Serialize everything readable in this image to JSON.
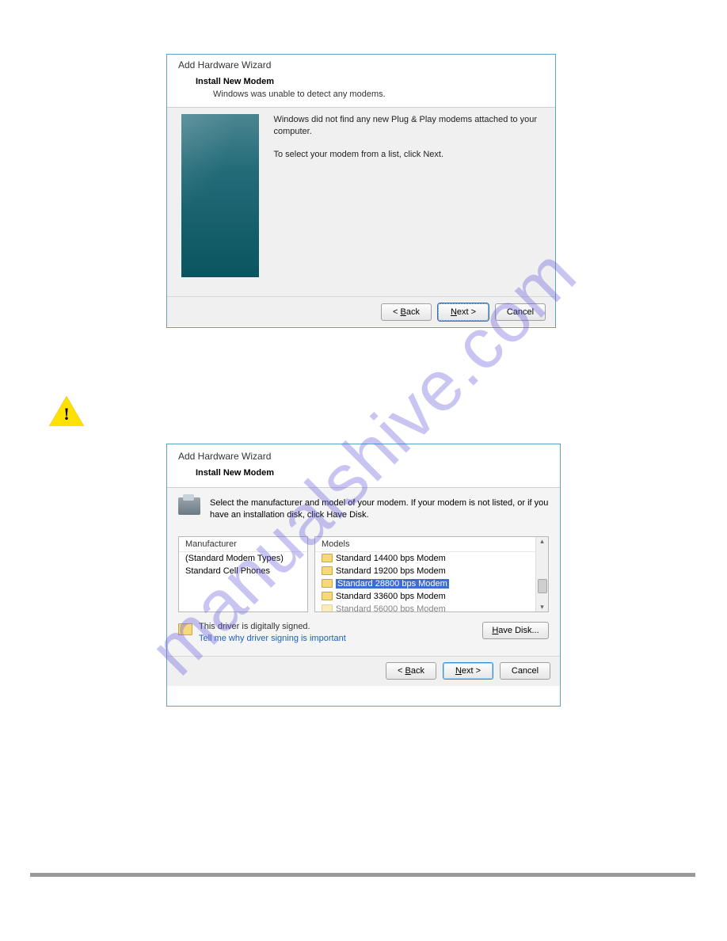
{
  "watermark": "manualshive.com",
  "dialog1": {
    "title": "Add Hardware Wizard",
    "subtitle": "Install New Modem",
    "subtext": "Windows was unable to detect any modems.",
    "body_line1": "Windows did not find any new Plug & Play modems attached to your computer.",
    "body_line2": "To select your modem from a list, click Next.",
    "back": "< Back",
    "next": "Next >",
    "cancel": "Cancel"
  },
  "dialog2": {
    "title": "Add Hardware Wizard",
    "subtitle": "Install New Modem",
    "instruction": "Select the manufacturer and model of your modem. If your modem is not listed, or if you have an installation disk, click Have Disk.",
    "manuf_hdr": "Manufacturer",
    "manuf_items": [
      "(Standard Modem Types)",
      "Standard Cell Phones"
    ],
    "models_hdr": "Models",
    "models_items": [
      "Standard 14400 bps Modem",
      "Standard 19200 bps Modem",
      "Standard 28800 bps Modem",
      "Standard 33600 bps Modem",
      "Standard 56000 bps Modem"
    ],
    "models_selected_index": 2,
    "signed_text": "This driver is digitally signed.",
    "sign_link": "Tell me why driver signing is important",
    "have_disk": "Have Disk...",
    "back": "< Back",
    "next": "Next >",
    "cancel": "Cancel"
  }
}
